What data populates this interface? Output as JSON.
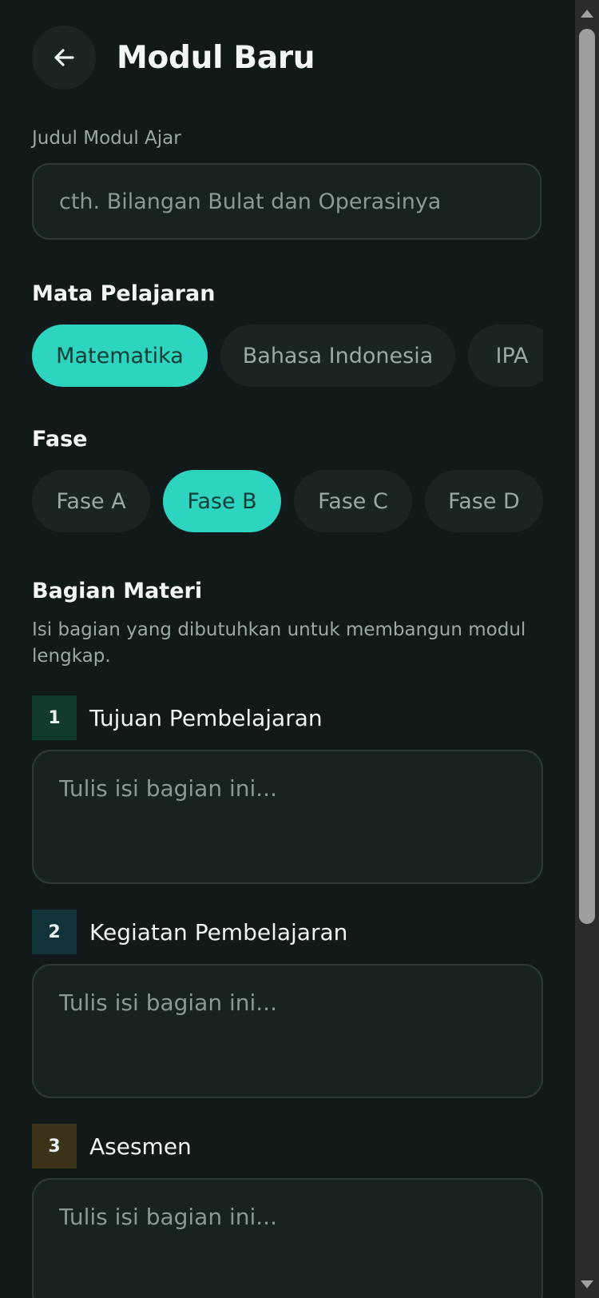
{
  "header": {
    "title": "Modul Baru",
    "back_icon": "arrow-left-icon"
  },
  "title_field": {
    "label": "Judul Modul Ajar",
    "placeholder": "cth. Bilangan Bulat dan Operasinya",
    "value": ""
  },
  "subject": {
    "heading": "Mata Pelajaran",
    "options": [
      "Matematika",
      "Bahasa Indonesia",
      "IPA"
    ],
    "selected": "Matematika"
  },
  "phase": {
    "heading": "Fase",
    "options": [
      "Fase A",
      "Fase B",
      "Fase C",
      "Fase D"
    ],
    "selected": "Fase B"
  },
  "materials": {
    "heading": "Bagian Materi",
    "description": "Isi bagian yang dibutuhkan untuk membangun modul lengkap.",
    "sections": [
      {
        "number": "1",
        "title": "Tujuan Pembelajaran",
        "placeholder": "Tulis isi bagian ini...",
        "color": "#133a2f"
      },
      {
        "number": "2",
        "title": "Kegiatan Pembelajaran",
        "placeholder": "Tulis isi bagian ini...",
        "color": "#123339"
      },
      {
        "number": "3",
        "title": "Asesmen",
        "placeholder": "Tulis isi bagian ini...",
        "color": "#3a331a"
      }
    ]
  },
  "colors": {
    "accent": "#2dd4bf",
    "background": "#121a19",
    "surface": "#182321"
  }
}
